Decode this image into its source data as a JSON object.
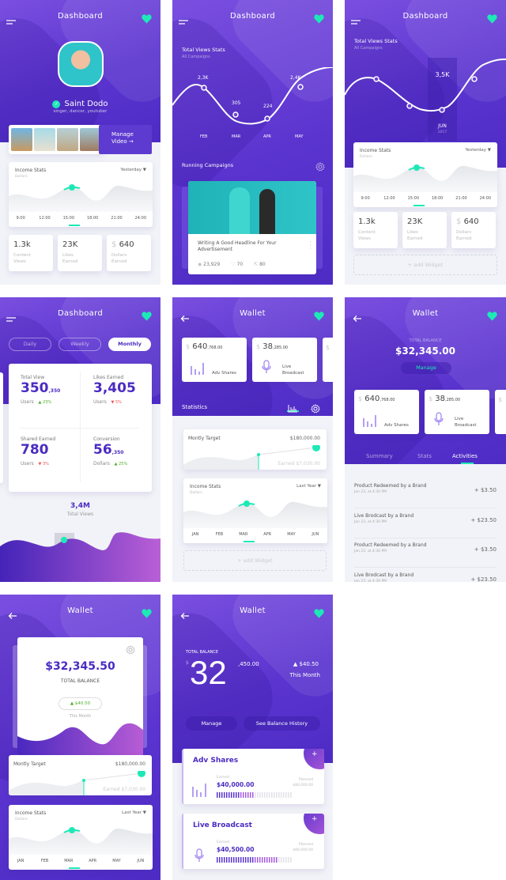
{
  "colors": {
    "primary": "#5b34cf",
    "accent": "#1de9b6",
    "text_purple": "#4a2bc2",
    "up": "#4caf28",
    "down": "#ef5350"
  },
  "icons": {
    "menu": "hamburger-menu-icon",
    "favorite": "heart-icon",
    "back": "arrow-left-icon",
    "settings": "gear-icon",
    "verified": "check-circle-icon",
    "chart": "bar-chart-icon",
    "mic": "microphone-icon",
    "views": "eye-icon",
    "likes": "heart-outline-icon",
    "shares": "share-icon",
    "add": "plus-icon"
  },
  "income_hours": {
    "title": "Income Stats",
    "subtitle": "Dollars",
    "dropdown": "Yesterday",
    "ticks": [
      "9:00",
      "12:00",
      "15:00",
      "18:00",
      "21:00",
      "24:00"
    ]
  },
  "income_months": {
    "title": "Income Stats",
    "subtitle": "Dollars",
    "dropdown": "Last Year",
    "ticks": [
      "JAN",
      "FEB",
      "MAR",
      "APR",
      "MAY",
      "JUN"
    ]
  },
  "quick_stats": [
    {
      "value": "1.3k",
      "label1": "Content",
      "label2": "Views"
    },
    {
      "value": "23K",
      "label1": "Likes",
      "label2": "Earned"
    },
    {
      "currency": "$",
      "value": "640",
      "label1": "Dollars",
      "label2": "Earned"
    }
  ],
  "add_widget": "+ add Widget",
  "target": {
    "title": "Montly Target",
    "goal": "$180,000.00",
    "earned_label": "Earned",
    "earned": "$7,030.00",
    "progress": 0.04
  },
  "wallet_cards": [
    {
      "currency": "$",
      "value": "640",
      "cents": ",768.00",
      "label": "Adv Shares"
    },
    {
      "currency": "$",
      "value": "38",
      "cents": ",285.00",
      "label1": "Live",
      "label2": "Broadcast"
    },
    {
      "currency": "$"
    }
  ],
  "s1": {
    "title": "Dashboard",
    "name": "Saint Dodo",
    "bio": "singer, dancer, youtuber",
    "manage": "Manage",
    "video": "Video →"
  },
  "s2": {
    "title": "Dashboard",
    "chart_title": "Total Views Stats",
    "chart_sub": "All Campaigns",
    "points": [
      "2,3K",
      "305",
      "224",
      "2,4K"
    ],
    "months": [
      "FEB",
      "MAR",
      "APR",
      "MAY"
    ],
    "section": "Running Campaigns",
    "headline": "Writing A Good Headline For Your Advertisement",
    "views": "23,929",
    "likes": "70",
    "shares": "80"
  },
  "s3": {
    "title": "Dashboard",
    "chart_title": "Total Views Stats",
    "chart_sub": "All Campaigns",
    "highlight_value": "3,5K",
    "highlight_month": "JUN",
    "highlight_year": "2017"
  },
  "s4": {
    "title": "Dashboard",
    "tabs": [
      "Daily",
      "Weekly",
      "Monthly"
    ],
    "active_tab": "Monthly",
    "stats": [
      {
        "label": "Total View",
        "value": "350",
        "small": ",350",
        "unit": "Users",
        "trend": "▲ 23%",
        "dir": "up"
      },
      {
        "label": "Likes Earned",
        "value": "3,405",
        "small": "",
        "unit": "Users",
        "trend": "▼ 5%",
        "dir": "down"
      },
      {
        "label": "Shared Earned",
        "value": "780",
        "small": "",
        "unit": "Users",
        "trend": "▼ 3%",
        "dir": "down"
      },
      {
        "label": "Conversion",
        "value": "56",
        "small": ",350",
        "unit": "Dollars",
        "trend": "▲ 25%",
        "dir": "up"
      }
    ],
    "total": "3,4M",
    "total_label": "Total Views"
  },
  "s5": {
    "title": "Wallet",
    "section": "Statistics"
  },
  "s6": {
    "title": "Wallet",
    "balance_label": "TOTAL BALANCE",
    "balance": "$32,345.00",
    "manage": "Manage",
    "tabs": [
      "Summary",
      "Stats",
      "Activities"
    ],
    "active_tab": "Activities",
    "activities": [
      {
        "title": "Product Redeemed by a Brand",
        "date": "Jan 23, at 4:30 PM",
        "amount": "+ $3.50"
      },
      {
        "title": "Live Brodcast by a Brand",
        "date": "Jan 23, at 4:30 PM",
        "amount": "+ $23.50"
      },
      {
        "title": "Product Redeemed by a Brand",
        "date": "Jan 23, at 4:30 PM",
        "amount": "+ $3.50"
      },
      {
        "title": "Live Brodcast by a Brand",
        "date": "Jan 23, at 4:30 PM",
        "amount": "+ $23.50"
      }
    ]
  },
  "s7": {
    "title": "Wallet",
    "balance": "$32,345.50",
    "balance_label": "TOTAL BALANCE",
    "change": "▲ $40.50",
    "change_label": "This Month"
  },
  "s8": {
    "title": "Wallet",
    "balance_label": "TOTAL BALANCE",
    "currency": "$",
    "big": "32",
    "small": ",450.00",
    "change": "▲ $40.50",
    "change_label": "This Month",
    "manage": "Manage",
    "history": "See Balance History",
    "cards": [
      {
        "title": "Adv Shares",
        "earned_label": "Earned",
        "earned": "$40,000.00",
        "planned_label": "Planned",
        "planned": "$80,000.00",
        "progress": 0.5
      },
      {
        "title": "Live Broadcast",
        "earned_label": "Earned",
        "earned": "$40,500.00",
        "planned_label": "Planned",
        "planned": "$80,000.00",
        "progress": 0.8
      }
    ]
  }
}
